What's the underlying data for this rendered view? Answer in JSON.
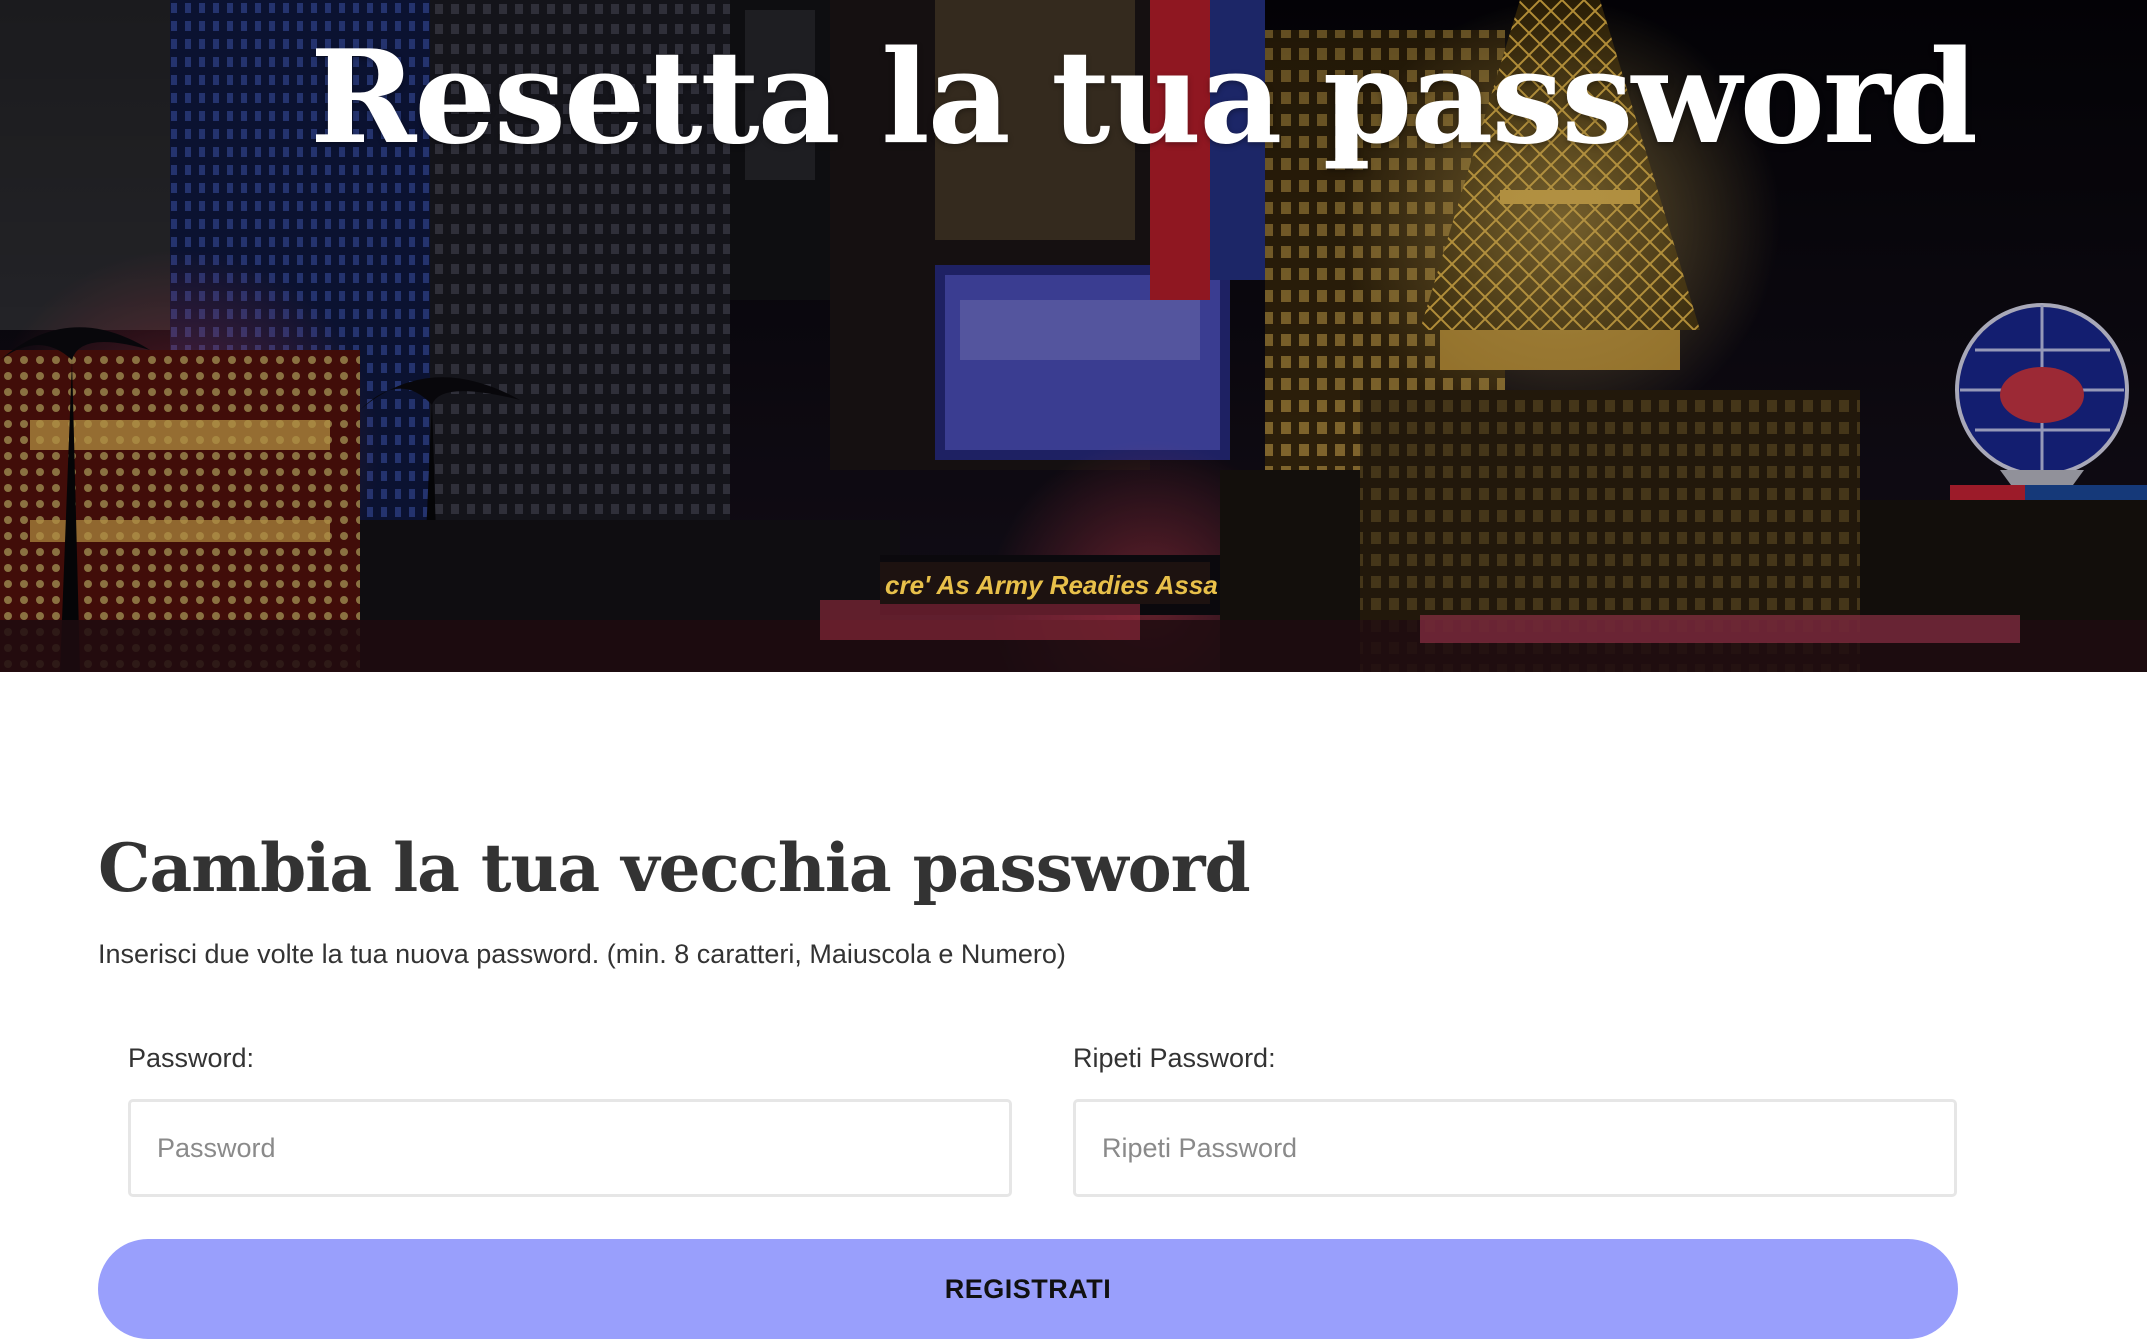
{
  "hero": {
    "title": "Resetta la tua password",
    "sign_text": "cre' As Army Readies Assa",
    "palette": {
      "sky": "#07060d",
      "building_warm": "#c99a3a",
      "building_blue": "#1b2a6b",
      "neon_red": "#d4263c",
      "neon_gold": "#f2c14e",
      "screen_blue": "#5b5fd9"
    }
  },
  "form": {
    "title": "Cambia la tua vecchia password",
    "description": "Inserisci due volte la tua nuova password. (min. 8 caratteri, Maiuscola e Numero)",
    "password": {
      "label": "Password:",
      "placeholder": "Password",
      "value": ""
    },
    "repeat_password": {
      "label": "Ripeti Password:",
      "placeholder": "Ripeti Password",
      "value": ""
    },
    "submit_label": "REGISTRATI",
    "accent_color": "#999ffc"
  }
}
